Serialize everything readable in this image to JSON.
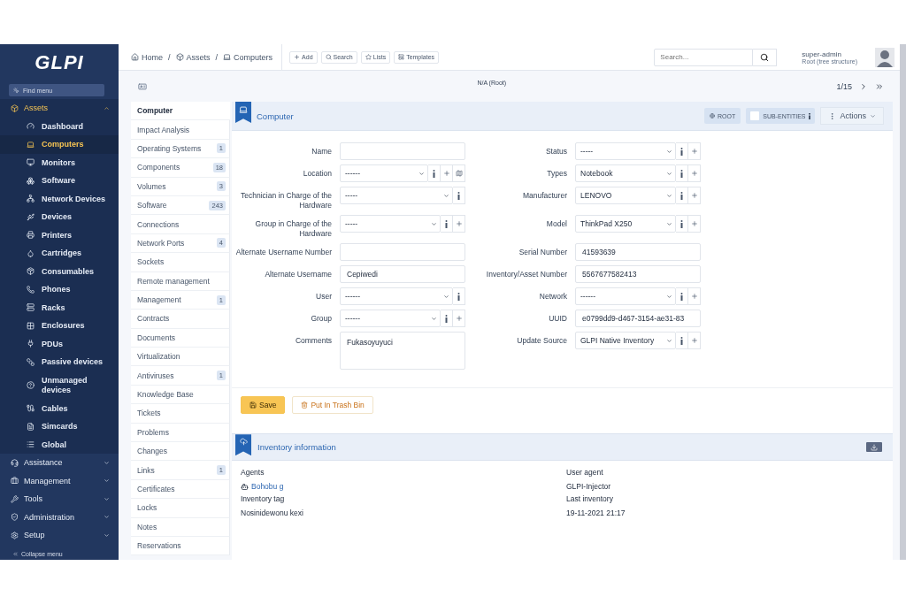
{
  "sidebar": {
    "logo": "GLPI",
    "find_menu": "Find menu",
    "sections": [
      {
        "label": "Assets",
        "expanded": true,
        "children": [
          {
            "label": "Dashboard",
            "selected": false
          },
          {
            "label": "Computers",
            "selected": true
          },
          {
            "label": "Monitors",
            "selected": false
          },
          {
            "label": "Software",
            "selected": false
          },
          {
            "label": "Network Devices",
            "selected": false
          },
          {
            "label": "Devices",
            "selected": false
          },
          {
            "label": "Printers",
            "selected": false
          },
          {
            "label": "Cartridges",
            "selected": false
          },
          {
            "label": "Consumables",
            "selected": false
          },
          {
            "label": "Phones",
            "selected": false
          },
          {
            "label": "Racks",
            "selected": false
          },
          {
            "label": "Enclosures",
            "selected": false
          },
          {
            "label": "PDUs",
            "selected": false
          },
          {
            "label": "Passive devices",
            "selected": false
          },
          {
            "label": "Unmanaged devices",
            "selected": false
          },
          {
            "label": "Cables",
            "selected": false
          },
          {
            "label": "Simcards",
            "selected": false
          },
          {
            "label": "Global",
            "selected": false
          }
        ]
      },
      {
        "label": "Assistance",
        "expanded": false
      },
      {
        "label": "Management",
        "expanded": false
      },
      {
        "label": "Tools",
        "expanded": false
      },
      {
        "label": "Administration",
        "expanded": false
      },
      {
        "label": "Setup",
        "expanded": false
      }
    ],
    "collapse": "Collapse menu"
  },
  "topbar": {
    "breadcrumbs": [
      {
        "label": "Home"
      },
      {
        "separator": "/",
        "label": "Assets"
      },
      {
        "separator": "/",
        "label": "Computers"
      }
    ],
    "buttons": [
      "Add",
      "Search",
      "Lists",
      "Templates"
    ],
    "search": {
      "placeholder": "Search..."
    },
    "user": {
      "name": "super-admin",
      "entity": "Root (tree structure)"
    }
  },
  "subbar": {
    "entity": "N/A (Root)",
    "pager": "1/15"
  },
  "tabs": [
    {
      "label": "Computer",
      "selected": true
    },
    {
      "label": "Impact Analysis",
      "selected": false
    },
    {
      "label": "Operating Systems",
      "count": "1",
      "selected": false
    },
    {
      "label": "Components",
      "count": "18",
      "selected": false
    },
    {
      "label": "Volumes",
      "count": "3",
      "selected": false
    },
    {
      "label": "Software",
      "count": "243",
      "selected": false
    },
    {
      "label": "Connections",
      "selected": false
    },
    {
      "label": "Network Ports",
      "count": "4",
      "selected": false
    },
    {
      "label": "Sockets",
      "selected": false
    },
    {
      "label": "Remote management",
      "selected": false
    },
    {
      "label": "Management",
      "count": "1",
      "selected": false
    },
    {
      "label": "Contracts",
      "selected": false
    },
    {
      "label": "Documents",
      "selected": false
    },
    {
      "label": "Virtualization",
      "selected": false
    },
    {
      "label": "Antiviruses",
      "count": "1",
      "selected": false
    },
    {
      "label": "Knowledge Base",
      "selected": false
    },
    {
      "label": "Tickets",
      "selected": false
    },
    {
      "label": "Problems",
      "selected": false
    },
    {
      "label": "Changes",
      "selected": false
    },
    {
      "label": "Links",
      "count": "1",
      "selected": false
    },
    {
      "label": "Certificates",
      "selected": false
    },
    {
      "label": "Locks",
      "selected": false
    },
    {
      "label": "Notes",
      "selected": false
    },
    {
      "label": "Reservations",
      "selected": false
    }
  ],
  "card": {
    "title": "Computer",
    "root_badge": "ROOT",
    "sub_entities": {
      "label": "SUB-ENTITIES",
      "checked": false
    },
    "actions": "Actions"
  },
  "form": [
    {
      "left": {
        "label": "Name",
        "kind": "text"
      },
      "right": {
        "label": "Status",
        "kind": "select",
        "value": "-----",
        "buttons": [
          {
            "kind": "info"
          },
          {
            "kind": "add"
          }
        ]
      }
    },
    {
      "left": {
        "label": "Location",
        "kind": "select",
        "value": "------",
        "buttons": [
          {
            "kind": "info"
          },
          {
            "kind": "add"
          },
          {
            "kind": "map"
          }
        ]
      },
      "right": {
        "label": "Types",
        "kind": "select",
        "value": "Notebook",
        "buttons": [
          {
            "kind": "info"
          },
          {
            "kind": "add"
          }
        ]
      }
    },
    {
      "left": {
        "label": "Technician in Charge of the Hardware",
        "kind": "select",
        "value": "-----",
        "buttons": [
          {
            "kind": "info"
          }
        ]
      },
      "right": {
        "label": "Manufacturer",
        "kind": "select",
        "value": "LENOVO",
        "buttons": [
          {
            "kind": "info"
          },
          {
            "kind": "add"
          }
        ]
      }
    },
    {
      "left": {
        "label": "Group in Charge of the Hardware",
        "kind": "select",
        "value": "-----",
        "buttons": [
          {
            "kind": "info"
          },
          {
            "kind": "add"
          }
        ]
      },
      "right": {
        "label": "Model",
        "kind": "select",
        "value": "ThinkPad X250",
        "buttons": [
          {
            "kind": "info"
          },
          {
            "kind": "add"
          }
        ]
      }
    },
    {
      "left": {
        "label": "Alternate Username Number",
        "kind": "text"
      },
      "right": {
        "label": "Serial Number",
        "kind": "text",
        "value": "41593639"
      }
    },
    {
      "left": {
        "label": "Alternate Username",
        "kind": "text",
        "value": "Cepiwedi"
      },
      "right": {
        "label": "Inventory/Asset Number",
        "kind": "text",
        "value": "5567677582413"
      }
    },
    {
      "left": {
        "label": "User",
        "kind": "select",
        "value": "------",
        "buttons": [
          {
            "kind": "info"
          }
        ]
      },
      "right": {
        "label": "Network",
        "kind": "select",
        "value": "------",
        "buttons": [
          {
            "kind": "info"
          },
          {
            "kind": "add"
          }
        ]
      }
    },
    {
      "left": {
        "label": "Group",
        "kind": "select",
        "value": "------",
        "buttons": [
          {
            "kind": "info"
          },
          {
            "kind": "add"
          }
        ]
      },
      "right": {
        "label": "UUID",
        "kind": "text",
        "value": "e0799dd9-d467-3154-ae31-83"
      }
    },
    {
      "left": {
        "label": "Comments",
        "kind": "textarea",
        "value": "Fukasoyuyuci"
      },
      "right": {
        "label": "Update Source",
        "kind": "select",
        "value": "GLPI Native Inventory",
        "buttons": [
          {
            "kind": "info"
          },
          {
            "kind": "add"
          }
        ]
      }
    }
  ],
  "footer_buttons": [
    {
      "label": "Save",
      "kind": "save"
    },
    {
      "label": "Put In Trash Bin",
      "kind": "trash"
    }
  ],
  "inventory": {
    "title": "Inventory information",
    "items": [
      {
        "label": "Agents",
        "value": "Bohobu g",
        "kind": "agent"
      },
      {
        "label": "User agent",
        "value": "GLPI-Injector",
        "kind": "plain"
      },
      {
        "label": "Inventory tag",
        "value": "Nosinidewonu kexi",
        "kind": "plain"
      },
      {
        "label": "Last inventory",
        "value": "19-11-2021 21:17",
        "kind": "plain"
      }
    ]
  }
}
